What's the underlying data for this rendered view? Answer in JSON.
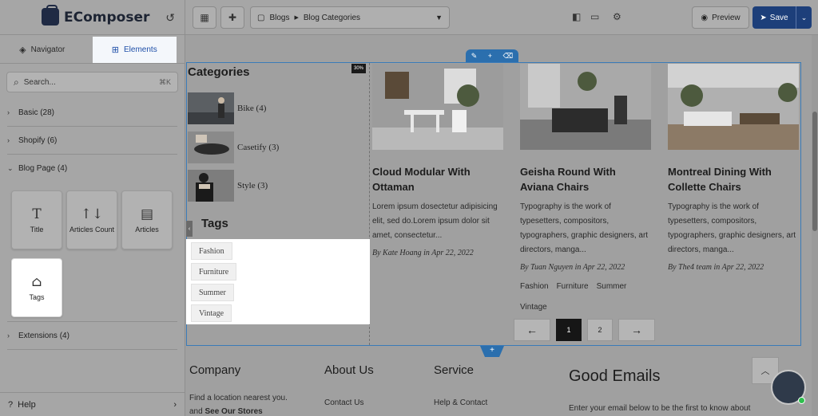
{
  "app": {
    "logo": "EComposer"
  },
  "sidebar": {
    "tabs": [
      {
        "label": "Navigator",
        "icon": "layers-icon"
      },
      {
        "label": "Elements",
        "icon": "grid-plus-icon"
      }
    ],
    "search": {
      "placeholder": "Search...",
      "shortcut": "⌘K"
    },
    "groups": {
      "basic": "Basic (28)",
      "shopify": "Shopify (6)",
      "blog_page": "Blog Page (4)",
      "extensions": "Extensions (4)"
    },
    "elements": [
      {
        "label": "Title",
        "icon": "T"
      },
      {
        "label": "Articles Count",
        "icon": "↑↓"
      },
      {
        "label": "Articles",
        "icon": "▤"
      },
      {
        "label": "Tags",
        "icon": "⌂"
      }
    ],
    "help": "Help"
  },
  "toolbar": {
    "breadcrumb_1": "Blogs",
    "breadcrumb_2": "Blog Categories",
    "preview": "Preview",
    "save": "Save"
  },
  "canvas": {
    "column_width_badge": "30%",
    "categories_title": "Categories",
    "categories": [
      {
        "label": "Bike (4)"
      },
      {
        "label": "Casetify (3)"
      },
      {
        "label": "Style (3)"
      }
    ],
    "tags_title": "Tags",
    "tags": [
      "Fashion",
      "Furniture",
      "Summer",
      "Vintage"
    ],
    "articles": [
      {
        "title": "Cloud Modular With Ottaman",
        "excerpt": "Lorem ipsum dosectetur adipisicing elit, sed do.Lorem ipsum dolor sit amet, consectetur...",
        "meta": "By Kate Hoang  in Apr 22, 2022",
        "tags": []
      },
      {
        "title": "Geisha Round With Aviana Chairs",
        "excerpt": "Typography is the work of typesetters, compositors, typographers, graphic designers, art directors, manga...",
        "meta": "By Tuan Nguyen  in Apr 22, 2022",
        "tags": [
          "Fashion",
          "Furniture",
          "Summer",
          "Vintage"
        ]
      },
      {
        "title": "Montreal Dining With Collette Chairs",
        "excerpt": "Typography is the work of typesetters, compositors, typographers, graphic designers, art directors, manga...",
        "meta": "By The4 team  in Apr 22, 2022",
        "tags": []
      }
    ],
    "pagination": {
      "prev": "←",
      "pages": [
        "1",
        "2"
      ],
      "next": "→",
      "active": "1"
    },
    "footer": {
      "company": "Company",
      "about": "About Us",
      "service": "Service",
      "newsletter_title": "Good Emails",
      "company_line_1": "Find a location nearest you.",
      "company_line_2_prefix": "and",
      "company_line_2_link": "See Our Stores",
      "about_link": "Contact Us",
      "service_link": "Help & Contact",
      "newsletter_text": "Enter your email below to be the first to know about"
    }
  }
}
